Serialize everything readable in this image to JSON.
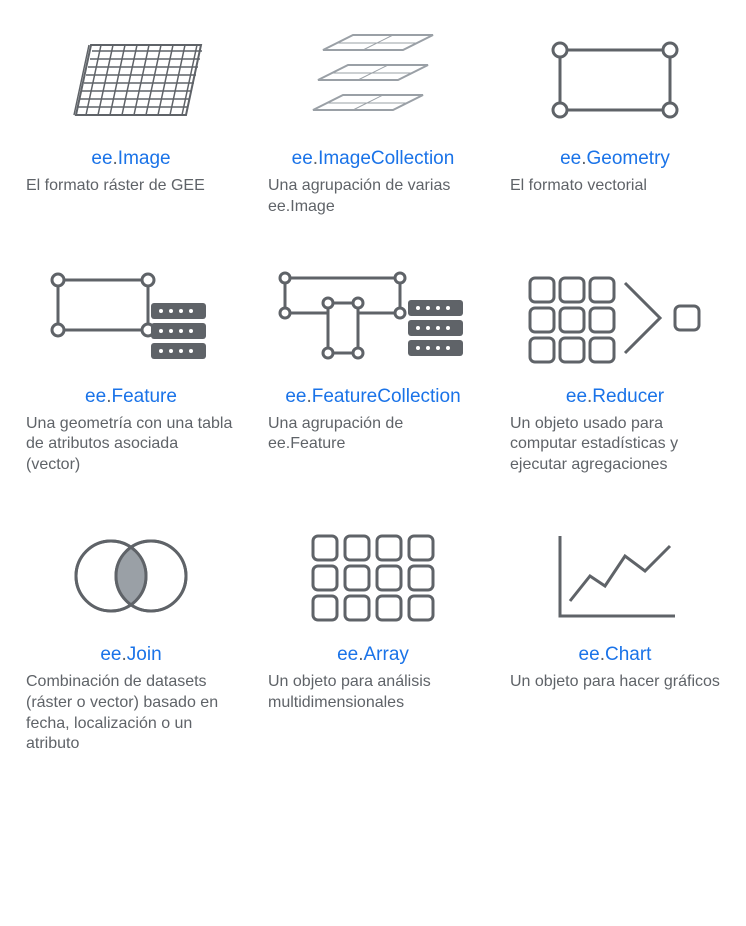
{
  "items": [
    {
      "icon": "raster-grid-icon",
      "prefix": "ee",
      "name": "Image",
      "desc": "El formato ráster de GEE"
    },
    {
      "icon": "stack-icon",
      "prefix": "ee",
      "name": "ImageCollection",
      "desc": "Una agrupación de varias ee.Image"
    },
    {
      "icon": "geometry-icon",
      "prefix": "ee",
      "name": "Geometry",
      "desc": "El formato vectorial"
    },
    {
      "icon": "feature-icon",
      "prefix": "ee",
      "name": "Feature",
      "desc": "Una geometría con una tabla de atributos asociada (vector)"
    },
    {
      "icon": "feature-collection-icon",
      "prefix": "ee",
      "name": "FeatureCollection",
      "desc": "Una agrupación de ee.Feature"
    },
    {
      "icon": "reducer-icon",
      "prefix": "ee",
      "name": "Reducer",
      "desc": "Un objeto usado para computar estadísticas y ejecutar agregaciones"
    },
    {
      "icon": "join-icon",
      "prefix": "ee",
      "name": "Join",
      "desc": "Combinación de datasets (ráster o vector) basado en fecha, localización o un atributo"
    },
    {
      "icon": "array-icon",
      "prefix": "ee",
      "name": "Array",
      "desc": "Un objeto para análisis multidimensionales"
    },
    {
      "icon": "chart-icon",
      "prefix": "ee",
      "name": "Chart",
      "desc": "Un objeto para hacer gráficos"
    }
  ]
}
